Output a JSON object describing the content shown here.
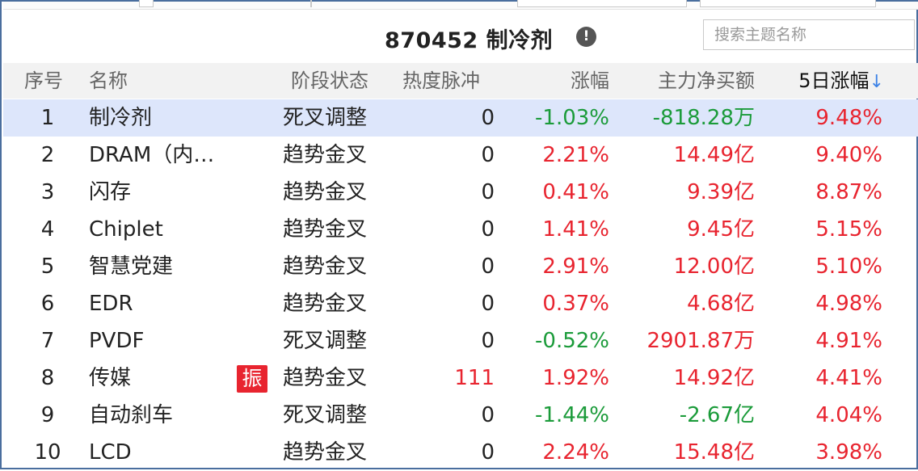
{
  "header_title": "870452 制冷剂",
  "search": {
    "placeholder": "搜索主题名称"
  },
  "columns": {
    "index": "序号",
    "name": "名称",
    "stage": "阶段状态",
    "heat": "热度脉冲",
    "change": "涨幅",
    "net_buy": "主力净买额",
    "five_day": "5日涨幅",
    "sort_indicator": "↓"
  },
  "badge_label": "振",
  "colors": {
    "up": "#e8242f",
    "down": "#1b9b3a",
    "selected_row": "#dde6fb",
    "sort_arrow": "#3c82e6"
  },
  "rows": [
    {
      "index": "1",
      "name": "制冷剂",
      "badge": false,
      "stage": "死叉调整",
      "heat": "0",
      "change": "-1.03%",
      "change_dir": "down",
      "net_buy": "-818.28万",
      "net_dir": "down",
      "five_day": "9.48%",
      "selected": true
    },
    {
      "index": "2",
      "name": "DRAM（内…",
      "badge": false,
      "stage": "趋势金叉",
      "heat": "0",
      "change": "2.21%",
      "change_dir": "up",
      "net_buy": "14.49亿",
      "net_dir": "up",
      "five_day": "9.40%"
    },
    {
      "index": "3",
      "name": "闪存",
      "badge": false,
      "stage": "趋势金叉",
      "heat": "0",
      "change": "0.41%",
      "change_dir": "up",
      "net_buy": "9.39亿",
      "net_dir": "up",
      "five_day": "8.87%"
    },
    {
      "index": "4",
      "name": "Chiplet",
      "badge": false,
      "stage": "趋势金叉",
      "heat": "0",
      "change": "1.41%",
      "change_dir": "up",
      "net_buy": "9.45亿",
      "net_dir": "up",
      "five_day": "5.15%"
    },
    {
      "index": "5",
      "name": "智慧党建",
      "badge": false,
      "stage": "趋势金叉",
      "heat": "0",
      "change": "2.91%",
      "change_dir": "up",
      "net_buy": "12.00亿",
      "net_dir": "up",
      "five_day": "5.10%"
    },
    {
      "index": "6",
      "name": "EDR",
      "badge": false,
      "stage": "趋势金叉",
      "heat": "0",
      "change": "0.37%",
      "change_dir": "up",
      "net_buy": "4.68亿",
      "net_dir": "up",
      "five_day": "4.98%"
    },
    {
      "index": "7",
      "name": "PVDF",
      "badge": false,
      "stage": "死叉调整",
      "heat": "0",
      "change": "-0.52%",
      "change_dir": "down",
      "net_buy": "2901.87万",
      "net_dir": "up",
      "five_day": "4.91%"
    },
    {
      "index": "8",
      "name": "传媒",
      "badge": true,
      "stage": "趋势金叉",
      "heat": "111",
      "change": "1.92%",
      "change_dir": "up",
      "net_buy": "14.92亿",
      "net_dir": "up",
      "five_day": "4.41%",
      "heat_dir": "up"
    },
    {
      "index": "9",
      "name": "自动刹车",
      "badge": false,
      "stage": "死叉调整",
      "heat": "0",
      "change": "-1.44%",
      "change_dir": "down",
      "net_buy": "-2.67亿",
      "net_dir": "down",
      "five_day": "4.04%"
    },
    {
      "index": "10",
      "name": "LCD",
      "badge": false,
      "stage": "趋势金叉",
      "heat": "0",
      "change": "2.24%",
      "change_dir": "up",
      "net_buy": "15.48亿",
      "net_dir": "up",
      "five_day": "3.98%"
    }
  ]
}
